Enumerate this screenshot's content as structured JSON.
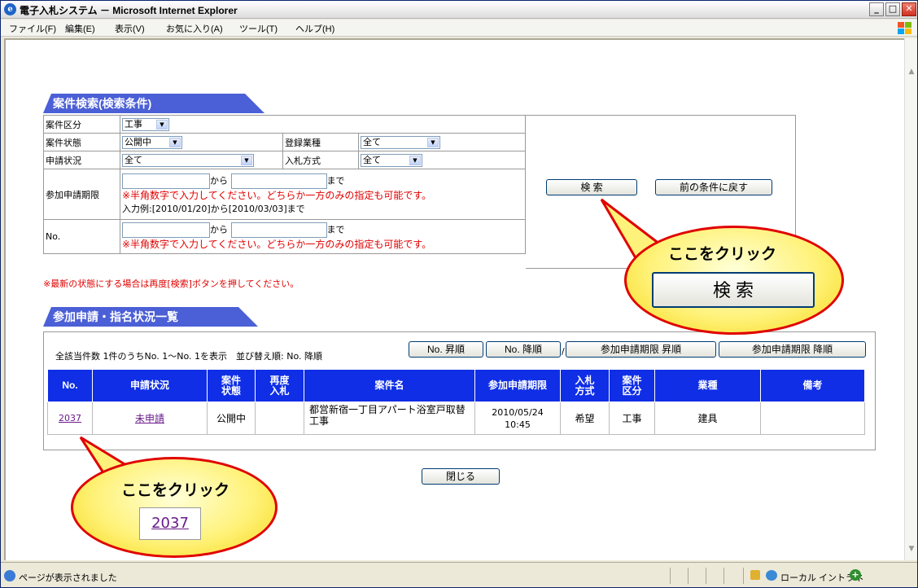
{
  "window": {
    "title": "電子入札システム － Microsoft Internet Explorer",
    "menu": [
      "ファイル(F)",
      "編集(E)",
      "表示(V)",
      "お気に入り(A)",
      "ツール(T)",
      "ヘルプ(H)"
    ]
  },
  "search": {
    "header": "案件検索(検索条件)",
    "row1_label": "案件区分",
    "row1_value": "工事",
    "row2_label": "案件状態",
    "row2_value": "公開中",
    "row2b_label": "登録業種",
    "row2b_value": "全て",
    "row3_label": "申請状況",
    "row3_value": "全て",
    "row3b_label": "入札方式",
    "row3b_value": "全て",
    "row4_label": "参加申請期限",
    "row4_from": "から",
    "row4_to": "まで",
    "row4_note": "※半角数字で入力してください。どちらか一方のみの指定も可能です。",
    "row4_example": "入力例:[2010/01/20]から[2010/03/03]まで",
    "row5_label": "No.",
    "row5_from": "から",
    "row5_to": "まで",
    "row5_note": "※半角数字で入力してください。どちらか一方のみの指定も可能です。",
    "search_button": "検 索",
    "back_button": "前の条件に戻す",
    "refresh_note": "※最新の状態にする場合は再度[検索]ボタンを押してください。"
  },
  "list": {
    "header": "参加申請・指名状況一覧",
    "info": "全該当件数 1件のうちNo. 1～No. 1を表示　並び替え順: No.  降順",
    "sort_buttons": [
      "No.  昇順",
      "No.  降順",
      "参加申請期限  昇順",
      "参加申請期限  降順"
    ],
    "separator": "/",
    "columns": [
      "No.",
      "申請状況",
      "案件\n状態",
      "再度\n入札",
      "案件名",
      "参加申請期限",
      "入札\n方式",
      "案件\n区分",
      "業種",
      "備考"
    ],
    "rows": [
      {
        "no": "2037",
        "status": "未申請",
        "state": "公開中",
        "rebid": "",
        "name": "都営新宿一丁目アパート浴室戸取替工事",
        "deadline_date": "2010/05/24",
        "deadline_time": "10:45",
        "method": "希望",
        "category": "工事",
        "industry": "建具",
        "note": ""
      }
    ],
    "close_button": "閉じる"
  },
  "callouts": {
    "right_title": "ここをクリック",
    "right_label": "検 索",
    "left_title": "ここをクリック",
    "left_label": "2037"
  },
  "statusbar": {
    "text": "ページが表示されました",
    "zone": "ローカル イントラネ"
  }
}
